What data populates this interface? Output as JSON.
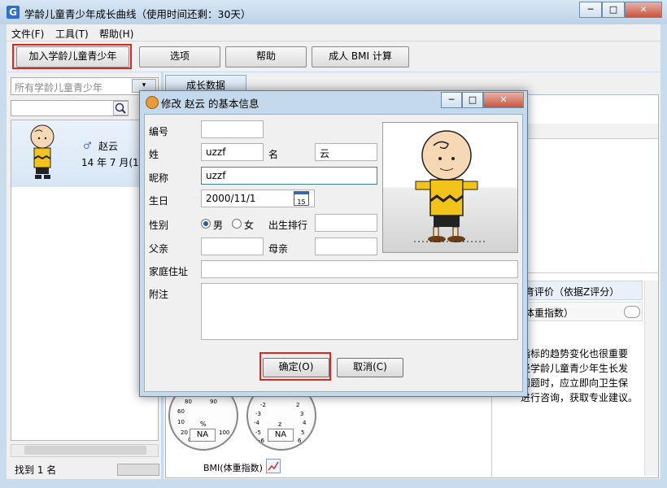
{
  "window": {
    "title": "学龄儿童青少年成长曲线（使用时间还剩：30天）",
    "app_icon": "G",
    "controls": [
      "─",
      "□",
      "✕"
    ]
  },
  "menubar": {
    "items": [
      "文件(F)",
      "工具(T)",
      "帮助(H)"
    ]
  },
  "toolbar": {
    "buttons": [
      "加入学龄儿童青少年",
      "选项",
      "帮助",
      "成人 BMI 计算"
    ],
    "highlight_color": "#e2241a"
  },
  "left_panel": {
    "filter_placeholder": "所有学龄儿童青少年",
    "person": {
      "name": "赵云",
      "date": "14 年 7 月(17"
    },
    "status": "找到 1 名"
  },
  "right_panel": {
    "tab": "成长数据",
    "eval_header": "育评价（依据Z评分）",
    "bmi_row": "体重指数）",
    "desc_lines": [
      "指标的趋势变化也很重要",
      "经学龄儿童青少年生长发",
      "问题时，应立即向卫生保",
      "进行咨询，获取专业建议。"
    ],
    "gauges": [
      {
        "ticks": [
          "80",
          "90",
          "60",
          "10",
          "20",
          "0",
          "100"
        ],
        "unit": "%",
        "value": "NA"
      },
      {
        "ticks": [
          "-2",
          "2",
          "-3",
          "3",
          "-4",
          "4",
          "-5",
          "5",
          "-6",
          "6"
        ],
        "unit": "z",
        "value": "NA"
      }
    ],
    "bmi_label": "BMI(体重指数)"
  },
  "dialog": {
    "title": "修改 赵云 的基本信息",
    "labels": {
      "id": "编号",
      "surname": "姓",
      "given": "名",
      "nickname": "昵称",
      "birthday": "生日",
      "gender": "性别",
      "birth_order": "出生排行",
      "father": "父亲",
      "mother": "母亲",
      "address": "家庭住址",
      "note": "附注"
    },
    "values": {
      "id": "",
      "surname": "uzzf",
      "given": "云",
      "nickname": "uzzf",
      "birthday": "2000/11/1",
      "father": "",
      "mother": "",
      "birth_order": "",
      "address": "",
      "note": ""
    },
    "gender_options": [
      "男",
      "女"
    ],
    "gender_selected": "男",
    "calendar_day": "15",
    "buttons": {
      "ok": "确定(O)",
      "cancel": "取消(C)"
    }
  }
}
